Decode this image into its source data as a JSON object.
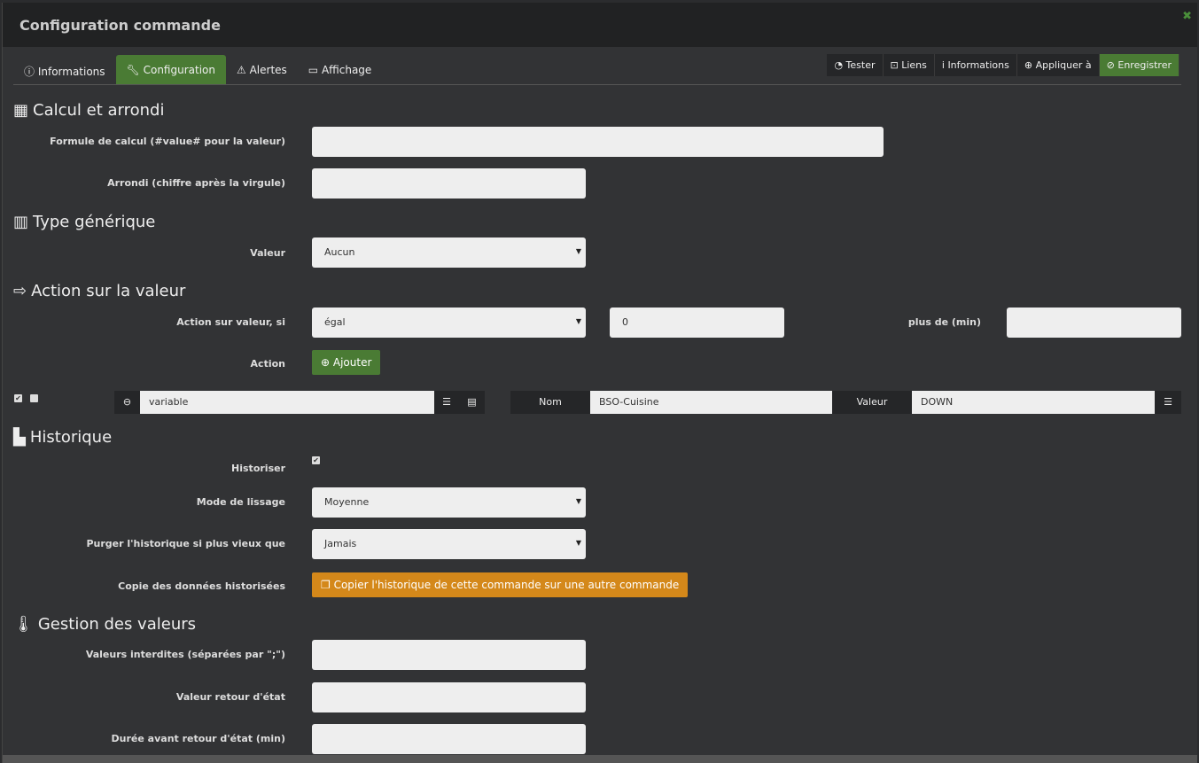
{
  "modal": {
    "title": "Configuration commande",
    "close_icon": "close-icon"
  },
  "tabs": [
    {
      "label": "Informations",
      "icon": "info-circle-icon"
    },
    {
      "label": "Configuration",
      "icon": "wrench-icon",
      "active": true
    },
    {
      "label": "Alertes",
      "icon": "warning-icon"
    },
    {
      "label": "Affichage",
      "icon": "monitor-icon"
    }
  ],
  "actions": [
    {
      "label": "Tester",
      "icon": "rss-icon"
    },
    {
      "label": "Liens",
      "icon": "link-icon"
    },
    {
      "label": "Informations",
      "icon": "info-icon"
    },
    {
      "label": "Appliquer à",
      "icon": "plus-circle-icon"
    },
    {
      "label": "Enregistrer",
      "icon": "check-circle-icon"
    }
  ],
  "colors": {
    "accent_green": "#4a7b34",
    "orange": "#d4881a"
  },
  "calc": {
    "title": "Calcul et arrondi",
    "formula_label": "Formule de calcul (#value# pour la valeur)",
    "formula_value": "",
    "round_label": "Arrondi (chiffre après la virgule)",
    "round_value": ""
  },
  "generic": {
    "title": "Type générique",
    "value_label": "Valeur",
    "value": "Aucun"
  },
  "action": {
    "title": "Action sur la valeur",
    "cond_label": "Action sur valeur, si",
    "cond_value": "égal",
    "cond_input": "0",
    "more_label": "plus de (min)",
    "more_value": "",
    "action_label": "Action",
    "add_button": "Ajouter",
    "row": {
      "enabled": true,
      "parallel": false,
      "cmd": "variable",
      "name_label": "Nom",
      "name_value": "BSO-Cuisine",
      "value_label": "Valeur",
      "value_value": "DOWN"
    }
  },
  "history": {
    "title": "Historique",
    "historize_label": "Historiser",
    "historize": true,
    "smooth_label": "Mode de lissage",
    "smooth_value": "Moyenne",
    "purge_label": "Purger l'historique si plus vieux que",
    "purge_value": "Jamais",
    "copy_label": "Copie des données historisées",
    "copy_button": "Copier l'historique de cette commande sur une autre commande"
  },
  "values": {
    "title": "Gestion des valeurs",
    "forbidden_label": "Valeurs interdites (séparées par \";\")",
    "return_label": "Valeur retour d'état",
    "duration_label": "Durée avant retour d'état (min)"
  }
}
